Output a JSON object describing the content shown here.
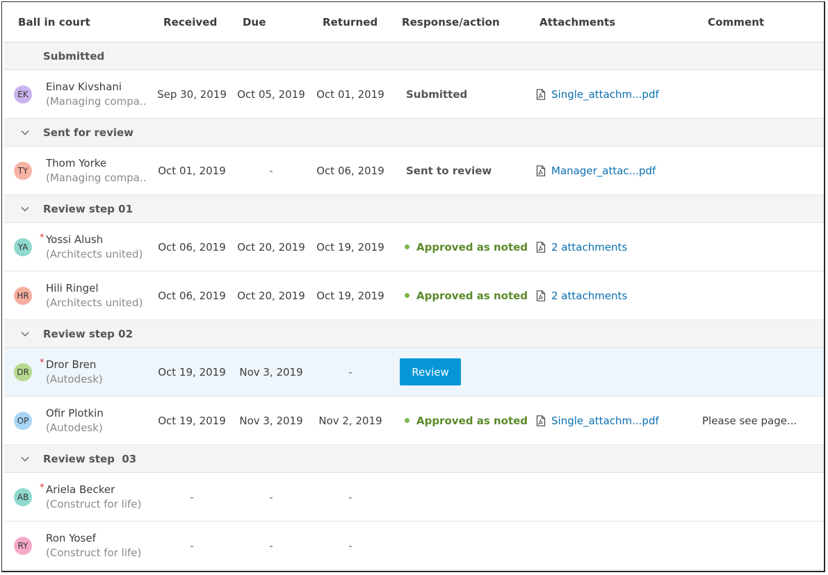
{
  "columns": {
    "ball": "Ball in court",
    "received": "Received",
    "due": "Due",
    "returned": "Returned",
    "response": "Response/action",
    "attachments": "Attachments",
    "comment": "Comment"
  },
  "groups": {
    "g0": "Submitted",
    "g1": "Sent for review",
    "g2": "Review step 01",
    "g3": "Review step 02",
    "g4": "Review step  03"
  },
  "rows": {
    "r0": {
      "initials": "EK",
      "name": "Einav Kivshani",
      "org": "(Managing compa..",
      "received": "Sep 30, 2019",
      "due": "Oct 05, 2019",
      "returned": "Oct 01, 2019",
      "response": "Submitted",
      "attachment": "Single_attachm...pdf",
      "comment": ""
    },
    "r1": {
      "initials": "TY",
      "name": "Thom Yorke",
      "org": "(Managing compa..",
      "received": "Oct 01, 2019",
      "due": "-",
      "returned": "Oct 06, 2019",
      "response": "Sent to review",
      "attachment": "Manager_attac...pdf",
      "comment": ""
    },
    "r2": {
      "initials": "YA",
      "required": "*",
      "name": "Yossi Alush",
      "org": "(Architects united)",
      "received": "Oct 06, 2019",
      "due": "Oct 20, 2019",
      "returned": "Oct 19, 2019",
      "response": "Approved as noted",
      "attachment": "2 attachments",
      "comment": ""
    },
    "r3": {
      "initials": "HR",
      "name": "Hili Ringel",
      "org": "(Architects united)",
      "received": "Oct 06, 2019",
      "due": "Oct 20, 2019",
      "returned": "Oct 19, 2019",
      "response": "Approved as noted",
      "attachment": "2 attachments",
      "comment": ""
    },
    "r4": {
      "initials": "DR",
      "required": "*",
      "name": "Dror Bren",
      "org": "(Autodesk)",
      "received": "Oct 19, 2019",
      "due": "Nov 3, 2019",
      "returned": "-",
      "response_button": "Review",
      "comment": ""
    },
    "r5": {
      "initials": "OP",
      "name": "Ofir Plotkin",
      "org": "(Autodesk)",
      "received": "Oct 19, 2019",
      "due": "Nov 3, 2019",
      "returned": "Nov 2, 2019",
      "response": "Approved as noted",
      "attachment": "Single_attachm...pdf",
      "comment": "Please see page..."
    },
    "r6": {
      "initials": "AB",
      "required": "*",
      "name": "Ariela Becker",
      "org": "(Construct for life)",
      "received": "-",
      "due": "-",
      "returned": "-"
    },
    "r7": {
      "initials": "RY",
      "name": "Ron Yosef",
      "org": "(Construct for life)",
      "received": "-",
      "due": "-",
      "returned": "-"
    }
  },
  "colors": {
    "avatar_EK": "#c9b4ef",
    "avatar_TY": "#f7b3a4",
    "avatar_YA": "#8fd9cf",
    "avatar_HR": "#f7ae9f",
    "avatar_DR": "#b7d98f",
    "avatar_OP": "#a9d6f5",
    "avatar_AB": "#8fd9cf",
    "avatar_RY": "#f5a8c8",
    "link": "#0a6fb0",
    "approved": "#5b8a2a",
    "button": "#0696d7"
  }
}
